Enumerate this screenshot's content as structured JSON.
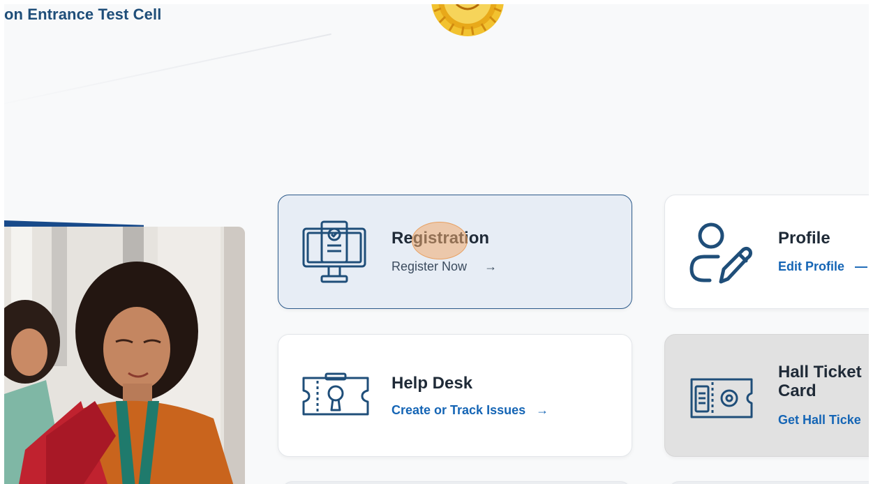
{
  "header": {
    "title": "on Entrance Test Cell"
  },
  "cards": {
    "registration": {
      "title": "Registration",
      "link": "Register Now",
      "arrow": "→"
    },
    "profile": {
      "title": "Profile",
      "link": "Edit Profile",
      "arrow": "—"
    },
    "helpdesk": {
      "title": "Help Desk",
      "link": "Create or Track Issues",
      "arrow": "→"
    },
    "hallticket": {
      "title_line1": "Hall Ticket",
      "title_line2": "Card",
      "link": "Get Hall Ticke"
    }
  },
  "icons": {
    "emblem": "state-emblem-icon",
    "registration": "computer-document-icon",
    "profile": "user-edit-icon",
    "helpdesk": "ticket-tools-icon",
    "hallticket": "ticket-gear-icon"
  },
  "colors": {
    "brand_blue": "#1f4e79",
    "link_blue": "#1565b5",
    "active_card_bg": "#e7edf5",
    "active_card_border": "#2c5a8a",
    "emblem_gold": "#e8b21c"
  }
}
